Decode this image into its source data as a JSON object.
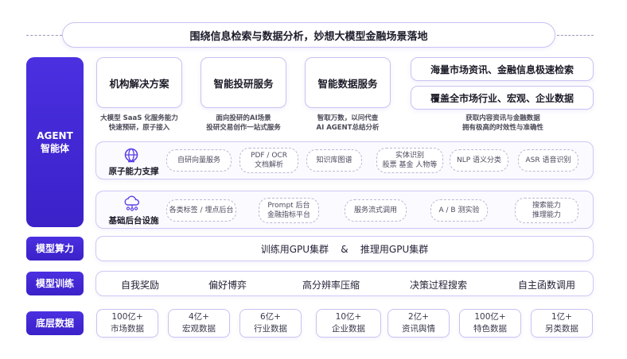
{
  "banner": "围绕信息检索与数据分析，妙想大模型金融场景落地",
  "agent": {
    "line1": "AGENT",
    "line2": "智能体"
  },
  "services": [
    {
      "title": "机构解决方案",
      "caption1": "大模型 SaaS 化服务能力",
      "caption2": "快速预研，原子接入"
    },
    {
      "title": "智能投研服务",
      "caption1": "面向投研的AI场景",
      "caption2": "投研交易创作一站式服务"
    },
    {
      "title": "智能数据服务",
      "caption1": "智取万数，以问代查",
      "caption2": "AI AGENT总结分析"
    }
  ],
  "search": {
    "item1": "海量市场资讯、金融信息极速检索",
    "item2": "覆盖全市场行业、宏观、企业数据",
    "caption1": "获取内容资讯与金融数据",
    "caption2": "拥有极高的时效性与准确性"
  },
  "atomic": {
    "label": "原子能力支撑",
    "icon": "globe-icon",
    "chips": [
      "自研向量服务",
      "PDF / OCR\n文档解析",
      "知识库图谱",
      "实体识别\n股票 基金 人物等",
      "NLP 语义分类",
      "ASR 语音识别"
    ]
  },
  "backend": {
    "label": "基础后台设施",
    "icon": "cloud-network-icon",
    "chips": [
      "各类标签 / 埋点后台",
      "Prompt 后台\n金融指标平台",
      "服务流式调用",
      "A / B 测实验",
      "搜索能力\n推理能力"
    ]
  },
  "compute": {
    "label": "模型算力",
    "text": "训练用GPU集群    &    推理用GPU集群"
  },
  "training": {
    "label": "模型训练",
    "items": [
      "自我奖励",
      "偏好博弈",
      "高分辨率压缩",
      "决策过程搜索",
      "自主函数调用"
    ]
  },
  "data": {
    "label": "底层数据",
    "items": [
      {
        "value": "100亿+",
        "name": "市场数据"
      },
      {
        "value": "4亿+",
        "name": "宏观数据"
      },
      {
        "value": "6亿+",
        "name": "行业数据"
      },
      {
        "value": "10亿+",
        "name": "企业数据"
      },
      {
        "value": "2亿+",
        "name": "资讯舆情"
      },
      {
        "value": "100亿+",
        "name": "特色数据"
      },
      {
        "value": "1亿+",
        "name": "另类数据"
      }
    ]
  }
}
